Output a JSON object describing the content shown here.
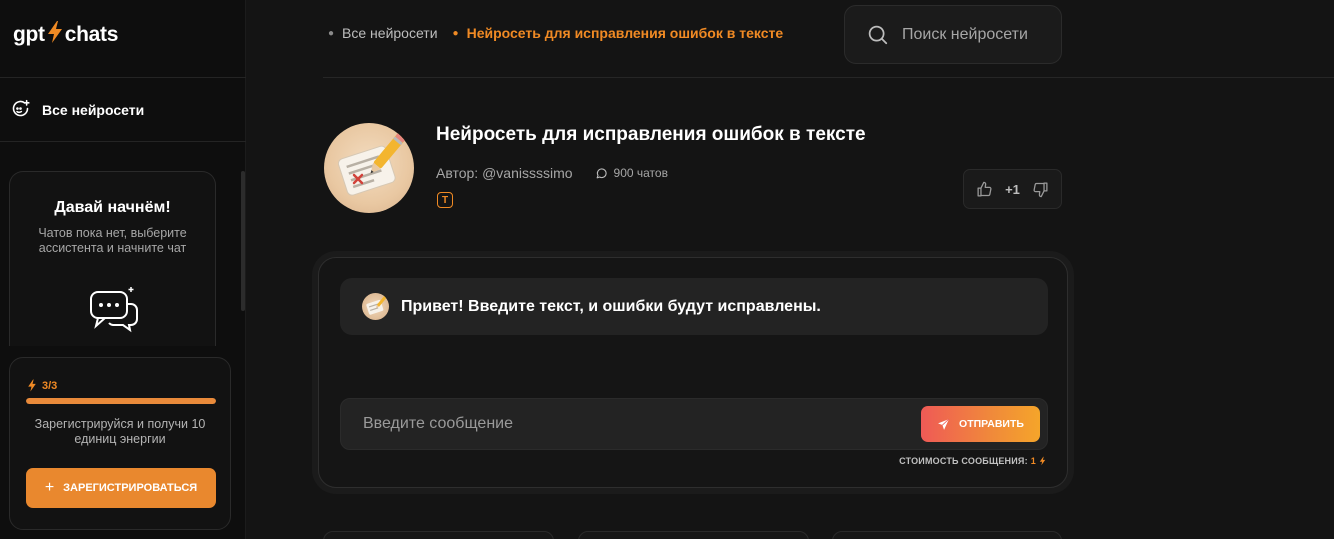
{
  "logo": {
    "left": "gpt",
    "bolt": "⚡",
    "right": "chats"
  },
  "sidebar": {
    "all_networks_label": "Все нейросети",
    "start_card": {
      "title": "Давай начнём!",
      "text": "Чатов пока нет, выберите ассистента и начните чат"
    },
    "energy": {
      "label": "3/3",
      "fraction": 1.0,
      "text": "Зарегистрируйся и получи 10 единиц энергии",
      "register_label": "ЗАРЕГИСТРИРОВАТЬСЯ",
      "accent": "#e9882e"
    }
  },
  "breadcrumbs": [
    {
      "label": "Все нейросети"
    },
    {
      "label": "Нейросеть для исправления ошибок в тексте"
    }
  ],
  "search": {
    "placeholder": "Поиск нейросети"
  },
  "assistant": {
    "title": "Нейросеть для исправления ошибок в тексте",
    "author": "Автор: @vanissssimo",
    "chats": "900 чатов",
    "tag": "T",
    "votes": "+1"
  },
  "chat": {
    "greeting": "Привет! Введите текст, и ошибки будут исправлены.",
    "input_placeholder": "Введите сообщение",
    "send_label": "ОТПРАВИТЬ",
    "cost_label": "СТОИМОСТЬ СООБЩЕНИЯ:",
    "cost_value": "1"
  },
  "colors": {
    "accent": "#f08a24",
    "background": "#141414",
    "sidebar": "#0e0e0e"
  }
}
